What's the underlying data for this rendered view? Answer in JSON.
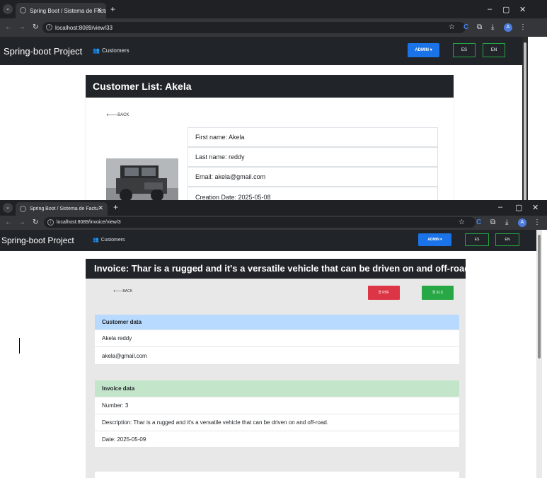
{
  "colors": {
    "chrome_dark": "#202124",
    "chrome_mid": "#35363a",
    "navbar": "#212529",
    "admin_blue": "#1a73e8",
    "lang_green": "#27a243",
    "pdf_red": "#dc3545",
    "xls_green": "#28a745",
    "customer_header": "#b8daff",
    "invoice_header": "#c3e6cb"
  },
  "shot1": {
    "tab_title": "Spring Boot / Sistema de Factu",
    "url": "localhost:8089/view/33",
    "navbar": {
      "brand": "Spring-boot Project",
      "customers": "Customers",
      "admin": "ADMIN",
      "lang_es": "ES",
      "lang_en": "EN"
    },
    "title": "Customer List: Akela",
    "back": "BACK",
    "details": [
      "First name: Akela",
      "Last name: reddy",
      "Email: akela@gmail.com",
      "Creation Date: 2025-05-08"
    ],
    "image_desc": "car-photo"
  },
  "shot2": {
    "tab_title": "Spring Boot / Sistema de Factu",
    "url": "localhost:8089/invoice/view/3",
    "navbar": {
      "brand": "Spring-boot Project",
      "customers": "Customers",
      "admin": "ADMIN",
      "lang_es": "ES",
      "lang_en": "EN"
    },
    "title": "Invoice: Thar is a rugged and it's a versatile vehicle that can be driven on and off-road.",
    "back": "BACK",
    "pdf": "PDF",
    "xls": "XLS",
    "customer": {
      "header": "Customer data",
      "name": "Akela reddy",
      "email": "akela@gmail.com"
    },
    "invoice": {
      "header": "Invoice data",
      "number": "Number: 3",
      "description": "Description: Thar is a rugged and it's a versatile vehicle that can be driven on and off-road.",
      "date": "Date: 2025-05-09"
    }
  }
}
